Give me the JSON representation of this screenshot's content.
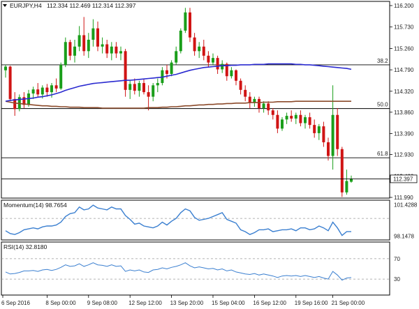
{
  "header": {
    "symbol_label": "EURJPY,H4",
    "ohlc": "112.334 112.469 112.314 112.397"
  },
  "colors": {
    "bull": "#1a9e1a",
    "bear": "#d01414",
    "ma_fast": "#2a2ad0",
    "ma_slow": "#8b4a2a",
    "indicator": "#3a7fd0",
    "price_tag_bg": "#ffffff"
  },
  "price_axis": {
    "ticks": [
      "116.200",
      "115.730",
      "115.260",
      "114.790",
      "114.320",
      "113.860",
      "113.390",
      "112.930",
      "112.460",
      "111.990"
    ],
    "range": [
      111.99,
      116.2
    ],
    "current_price": "112.397"
  },
  "fibonacci": [
    {
      "label": "38.2",
      "price": 114.9
    },
    {
      "label": "50.0",
      "price": 113.94
    },
    {
      "label": "61.8",
      "price": 112.86
    }
  ],
  "current_price_line": 112.397,
  "time_axis": {
    "labels": [
      "6 Sep 2016",
      "8 Sep 00:00",
      "9 Sep 08:00",
      "12 Sep 12:00",
      "13 Sep 20:00",
      "15 Sep 04:00",
      "16 Sep 12:00",
      "19 Sep 16:00",
      "21 Sep 00:00"
    ]
  },
  "momentum": {
    "title": "Momentum(14) 98.7654",
    "ticks": [
      "101.4288",
      "100",
      "98.1478"
    ],
    "range": [
      97.8,
      101.7
    ]
  },
  "rsi": {
    "title": "RSI(14) 32.8180",
    "ticks": [
      "70",
      "30"
    ],
    "range": [
      0,
      100
    ]
  },
  "chart_data": {
    "type": "candlestick",
    "candles": [
      {
        "o": 114.78,
        "h": 114.9,
        "l": 114.62,
        "c": 114.86
      },
      {
        "o": 114.86,
        "h": 114.88,
        "l": 114.1,
        "c": 114.15
      },
      {
        "o": 114.15,
        "h": 114.3,
        "l": 113.78,
        "c": 113.93
      },
      {
        "o": 113.93,
        "h": 114.25,
        "l": 113.88,
        "c": 114.19
      },
      {
        "o": 114.19,
        "h": 114.3,
        "l": 113.95,
        "c": 114.02
      },
      {
        "o": 114.02,
        "h": 114.35,
        "l": 113.98,
        "c": 114.27
      },
      {
        "o": 114.27,
        "h": 114.42,
        "l": 114.15,
        "c": 114.36
      },
      {
        "o": 114.36,
        "h": 114.5,
        "l": 114.2,
        "c": 114.25
      },
      {
        "o": 114.25,
        "h": 114.45,
        "l": 114.16,
        "c": 114.4
      },
      {
        "o": 114.4,
        "h": 114.48,
        "l": 114.2,
        "c": 114.3
      },
      {
        "o": 114.3,
        "h": 114.5,
        "l": 114.18,
        "c": 114.45
      },
      {
        "o": 114.45,
        "h": 114.6,
        "l": 114.3,
        "c": 114.38
      },
      {
        "o": 114.38,
        "h": 114.95,
        "l": 114.35,
        "c": 114.9
      },
      {
        "o": 114.9,
        "h": 115.5,
        "l": 114.85,
        "c": 115.4
      },
      {
        "o": 115.4,
        "h": 115.45,
        "l": 115.0,
        "c": 115.1
      },
      {
        "o": 115.1,
        "h": 115.45,
        "l": 114.95,
        "c": 115.3
      },
      {
        "o": 115.3,
        "h": 115.75,
        "l": 115.2,
        "c": 115.55
      },
      {
        "o": 115.55,
        "h": 115.95,
        "l": 115.1,
        "c": 115.2
      },
      {
        "o": 115.2,
        "h": 115.6,
        "l": 115.05,
        "c": 115.45
      },
      {
        "o": 115.45,
        "h": 115.9,
        "l": 115.3,
        "c": 115.7
      },
      {
        "o": 115.7,
        "h": 115.85,
        "l": 115.2,
        "c": 115.3
      },
      {
        "o": 115.3,
        "h": 115.5,
        "l": 115.15,
        "c": 115.35
      },
      {
        "o": 115.35,
        "h": 115.45,
        "l": 115.05,
        "c": 115.15
      },
      {
        "o": 115.15,
        "h": 115.4,
        "l": 115.0,
        "c": 115.3
      },
      {
        "o": 115.3,
        "h": 115.4,
        "l": 115.05,
        "c": 115.15
      },
      {
        "o": 115.15,
        "h": 115.3,
        "l": 115.0,
        "c": 115.2
      },
      {
        "o": 115.2,
        "h": 115.25,
        "l": 114.2,
        "c": 114.35
      },
      {
        "o": 114.35,
        "h": 114.55,
        "l": 114.15,
        "c": 114.48
      },
      {
        "o": 114.48,
        "h": 114.6,
        "l": 114.25,
        "c": 114.33
      },
      {
        "o": 114.33,
        "h": 114.55,
        "l": 114.2,
        "c": 114.5
      },
      {
        "o": 114.5,
        "h": 114.6,
        "l": 114.25,
        "c": 114.3
      },
      {
        "o": 114.3,
        "h": 114.45,
        "l": 113.9,
        "c": 114.2
      },
      {
        "o": 114.2,
        "h": 114.5,
        "l": 114.1,
        "c": 114.45
      },
      {
        "o": 114.45,
        "h": 114.6,
        "l": 114.3,
        "c": 114.5
      },
      {
        "o": 114.5,
        "h": 114.85,
        "l": 114.45,
        "c": 114.78
      },
      {
        "o": 114.78,
        "h": 114.9,
        "l": 114.6,
        "c": 114.7
      },
      {
        "o": 114.7,
        "h": 115.0,
        "l": 114.65,
        "c": 114.95
      },
      {
        "o": 114.95,
        "h": 115.3,
        "l": 114.9,
        "c": 115.2
      },
      {
        "o": 115.2,
        "h": 115.7,
        "l": 115.15,
        "c": 115.65
      },
      {
        "o": 115.65,
        "h": 116.15,
        "l": 115.6,
        "c": 116.05
      },
      {
        "o": 116.05,
        "h": 116.15,
        "l": 115.4,
        "c": 115.5
      },
      {
        "o": 115.5,
        "h": 115.6,
        "l": 115.1,
        "c": 115.2
      },
      {
        "o": 115.2,
        "h": 115.4,
        "l": 115.05,
        "c": 115.3
      },
      {
        "o": 115.3,
        "h": 115.45,
        "l": 115.0,
        "c": 115.1
      },
      {
        "o": 115.1,
        "h": 115.2,
        "l": 114.85,
        "c": 114.95
      },
      {
        "o": 114.95,
        "h": 115.15,
        "l": 114.9,
        "c": 115.05
      },
      {
        "o": 115.05,
        "h": 115.1,
        "l": 114.7,
        "c": 114.8
      },
      {
        "o": 114.8,
        "h": 115.0,
        "l": 114.72,
        "c": 114.92
      },
      {
        "o": 114.92,
        "h": 114.95,
        "l": 114.55,
        "c": 114.65
      },
      {
        "o": 114.65,
        "h": 114.85,
        "l": 114.6,
        "c": 114.78
      },
      {
        "o": 114.78,
        "h": 114.8,
        "l": 114.45,
        "c": 114.55
      },
      {
        "o": 114.55,
        "h": 114.6,
        "l": 114.25,
        "c": 114.35
      },
      {
        "o": 114.35,
        "h": 114.45,
        "l": 114.1,
        "c": 114.2
      },
      {
        "o": 114.2,
        "h": 114.3,
        "l": 113.95,
        "c": 114.08
      },
      {
        "o": 114.08,
        "h": 114.2,
        "l": 113.98,
        "c": 114.15
      },
      {
        "o": 114.15,
        "h": 114.2,
        "l": 113.85,
        "c": 113.95
      },
      {
        "o": 113.95,
        "h": 114.1,
        "l": 113.85,
        "c": 114.05
      },
      {
        "o": 114.05,
        "h": 114.1,
        "l": 113.8,
        "c": 113.9
      },
      {
        "o": 113.9,
        "h": 113.95,
        "l": 113.7,
        "c": 113.8
      },
      {
        "o": 113.8,
        "h": 113.9,
        "l": 113.4,
        "c": 113.5
      },
      {
        "o": 113.5,
        "h": 113.75,
        "l": 113.45,
        "c": 113.7
      },
      {
        "o": 113.7,
        "h": 113.85,
        "l": 113.6,
        "c": 113.78
      },
      {
        "o": 113.78,
        "h": 113.9,
        "l": 113.65,
        "c": 113.72
      },
      {
        "o": 113.72,
        "h": 113.85,
        "l": 113.6,
        "c": 113.8
      },
      {
        "o": 113.8,
        "h": 113.9,
        "l": 113.55,
        "c": 113.62
      },
      {
        "o": 113.62,
        "h": 113.8,
        "l": 113.5,
        "c": 113.75
      },
      {
        "o": 113.75,
        "h": 113.85,
        "l": 113.5,
        "c": 113.58
      },
      {
        "o": 113.58,
        "h": 113.7,
        "l": 113.3,
        "c": 113.4
      },
      {
        "o": 113.4,
        "h": 113.6,
        "l": 113.25,
        "c": 113.55
      },
      {
        "o": 113.55,
        "h": 113.65,
        "l": 113.1,
        "c": 113.2
      },
      {
        "o": 113.2,
        "h": 113.3,
        "l": 112.8,
        "c": 112.9
      },
      {
        "o": 112.9,
        "h": 114.45,
        "l": 112.6,
        "c": 113.8
      },
      {
        "o": 113.8,
        "h": 113.95,
        "l": 112.9,
        "c": 113.05
      },
      {
        "o": 113.05,
        "h": 113.1,
        "l": 112.0,
        "c": 112.1
      },
      {
        "o": 112.1,
        "h": 112.6,
        "l": 112.05,
        "c": 112.35
      },
      {
        "o": 112.334,
        "h": 112.469,
        "l": 112.314,
        "c": 112.397
      }
    ],
    "ma_fast": [
      114.1,
      114.12,
      114.13,
      114.14,
      114.15,
      114.16,
      114.17,
      114.19,
      114.2,
      114.22,
      114.24,
      114.27,
      114.3,
      114.34,
      114.37,
      114.4,
      114.43,
      114.45,
      114.47,
      114.49,
      114.5,
      114.51,
      114.52,
      114.53,
      114.54,
      114.55,
      114.56,
      114.56,
      114.57,
      114.58,
      114.59,
      114.6,
      114.61,
      114.62,
      114.63,
      114.65,
      114.67,
      114.69,
      114.72,
      114.75,
      114.78,
      114.8,
      114.82,
      114.84,
      114.85,
      114.86,
      114.87,
      114.88,
      114.88,
      114.89,
      114.89,
      114.9,
      114.9,
      114.9,
      114.91,
      114.91,
      114.91,
      114.92,
      114.92,
      114.92,
      114.92,
      114.92,
      114.92,
      114.91,
      114.91,
      114.9,
      114.9,
      114.89,
      114.88,
      114.87,
      114.86,
      114.85,
      114.84,
      114.83,
      114.82,
      114.8
    ],
    "ma_slow": [
      114.1,
      114.08,
      114.06,
      114.05,
      114.04,
      114.03,
      114.02,
      114.01,
      114.0,
      114.0,
      113.99,
      113.99,
      113.98,
      113.98,
      113.97,
      113.97,
      113.97,
      113.96,
      113.96,
      113.96,
      113.96,
      113.95,
      113.95,
      113.95,
      113.95,
      113.95,
      113.95,
      113.95,
      113.95,
      113.95,
      113.95,
      113.96,
      113.96,
      113.96,
      113.97,
      113.97,
      113.98,
      113.98,
      113.99,
      114.0,
      114.0,
      114.01,
      114.02,
      114.02,
      114.03,
      114.03,
      114.04,
      114.04,
      114.05,
      114.05,
      114.06,
      114.06,
      114.06,
      114.07,
      114.07,
      114.07,
      114.08,
      114.08,
      114.08,
      114.09,
      114.09,
      114.09,
      114.09,
      114.1,
      114.1,
      114.1,
      114.1,
      114.1,
      114.1,
      114.1,
      114.1,
      114.1,
      114.1,
      114.1,
      114.1,
      114.1
    ],
    "momentum": [
      98.7,
      98.4,
      98.3,
      98.5,
      98.8,
      98.9,
      99.0,
      98.9,
      99.1,
      99.2,
      99.2,
      99.3,
      99.6,
      100.2,
      100.5,
      100.6,
      101.2,
      100.9,
      101.0,
      101.4,
      101.1,
      101.0,
      100.9,
      101.2,
      101.0,
      101.0,
      100.3,
      99.9,
      99.4,
      99.5,
      99.2,
      99.1,
      99.0,
      99.2,
      99.6,
      99.3,
      99.7,
      100.0,
      100.6,
      101.0,
      100.8,
      100.1,
      99.8,
      99.9,
      100.0,
      100.2,
      100.4,
      100.6,
      99.9,
      99.7,
      99.5,
      98.8,
      98.6,
      98.3,
      98.5,
      98.8,
      98.8,
      98.9,
      98.6,
      98.7,
      98.8,
      98.8,
      98.9,
      98.7,
      99.0,
      99.0,
      98.8,
      98.9,
      99.2,
      99.0,
      98.7,
      99.6,
      99.0,
      98.2,
      98.6,
      98.6
    ],
    "rsi": [
      44,
      40,
      41,
      43,
      46,
      46,
      47,
      45,
      48,
      49,
      47,
      49,
      53,
      58,
      55,
      56,
      60,
      55,
      58,
      62,
      58,
      57,
      55,
      58,
      55,
      56,
      45,
      48,
      46,
      48,
      44,
      43,
      48,
      49,
      52,
      50,
      53,
      55,
      58,
      62,
      56,
      52,
      54,
      52,
      50,
      51,
      48,
      50,
      46,
      48,
      44,
      42,
      40,
      39,
      41,
      38,
      40,
      38,
      36,
      33,
      36,
      37,
      36,
      37,
      35,
      37,
      35,
      33,
      35,
      32,
      30,
      45,
      38,
      28,
      32,
      33
    ]
  }
}
